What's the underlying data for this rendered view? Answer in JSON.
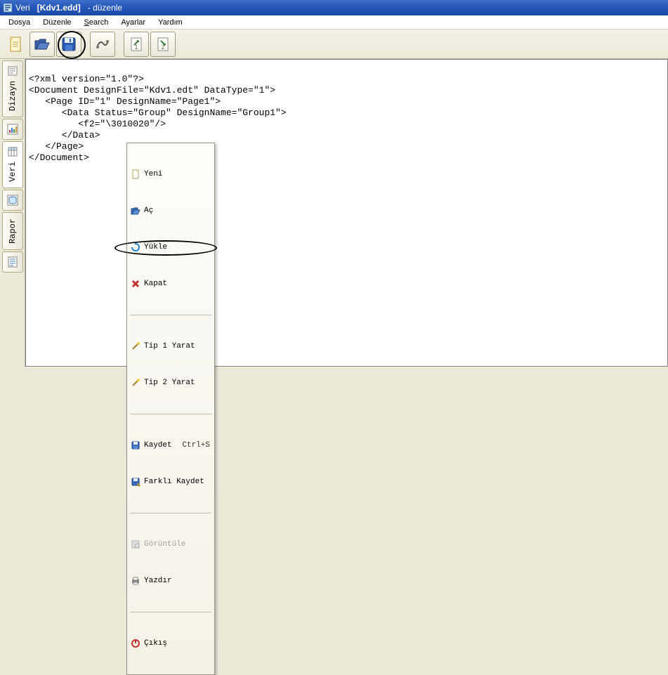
{
  "title": {
    "app": "Veri",
    "doc": "[Kdv1.edd]",
    "suffix": "- düzenle"
  },
  "menubar": {
    "dosya": "Dosya",
    "duzenle": "Düzenle",
    "search": "Search",
    "ayarlar": "Ayarlar",
    "yardim": "Yardım"
  },
  "left_tabs": {
    "dizayn": "Dizayn",
    "veri": "Veri",
    "rapor": "Rapor"
  },
  "editor": {
    "line1": "<?xml version=\"1.0\"?>",
    "line2": "<Document DesignFile=\"Kdv1.edt\" DataType=\"1\">",
    "line3": "   <Page ID=\"1\" DesignName=\"Page1\">",
    "line4": "      <Data Status=\"Group\" DesignName=\"Group1\">",
    "line5": "         <f2=\"\\3010020\"/>",
    "line6": "      </Data>",
    "line7": "   </Page>",
    "line8": "</Document>"
  },
  "context_menu": {
    "yeni": "Yeni",
    "ac": "Aç",
    "yukle": "Yükle",
    "kapat": "Kapat",
    "tip1": "Tip 1 Yarat",
    "tip2": "Tip 2 Yarat",
    "kaydet": "Kaydet",
    "kaydet_accel": "Ctrl+S",
    "farkli": "Farklı Kaydet",
    "goruntule": "Görüntüle",
    "yazdir": "Yazdır",
    "cikis": "Çıkış"
  }
}
